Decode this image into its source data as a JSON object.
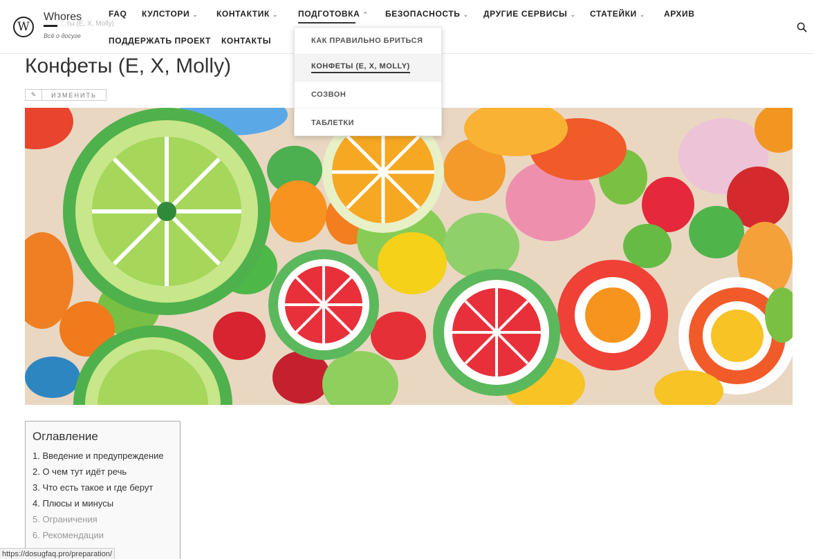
{
  "site": {
    "title": "Whores",
    "tagline": "Всё о досуге",
    "logo_letter": "W",
    "ghost_breadcrumb": "…ты (E, X, Molly)"
  },
  "nav": {
    "faq": "FAQ",
    "kulstori": "Кулстори",
    "kontaktik": "Контактик",
    "podgotovka": "Подготовка",
    "bezopasnost": "Безопасность",
    "drugie": "Другие сервисы",
    "stateyki": "Статейки",
    "arhiv": "Архив",
    "podderzhat": "Поддержать проект",
    "kontakty": "Контакты"
  },
  "dropdown": {
    "items": [
      "Как правильно бриться",
      "Конфеты (E, X, Molly)",
      "Созвон",
      "Таблетки"
    ]
  },
  "page": {
    "title": "Конфеты (E, X, Molly)",
    "edit_label": "ИЗМЕНИТЬ"
  },
  "toc": {
    "title": "Оглавление",
    "items": [
      "1. Введение и предупреждение",
      "2. О чем тут идёт речь",
      "3. Что есть такое и где берут",
      "4. Плюсы и минусы",
      "5. Ограничения",
      "6. Рекомендации"
    ]
  },
  "status_url": "https://dosugfaq.pro/preparation/"
}
